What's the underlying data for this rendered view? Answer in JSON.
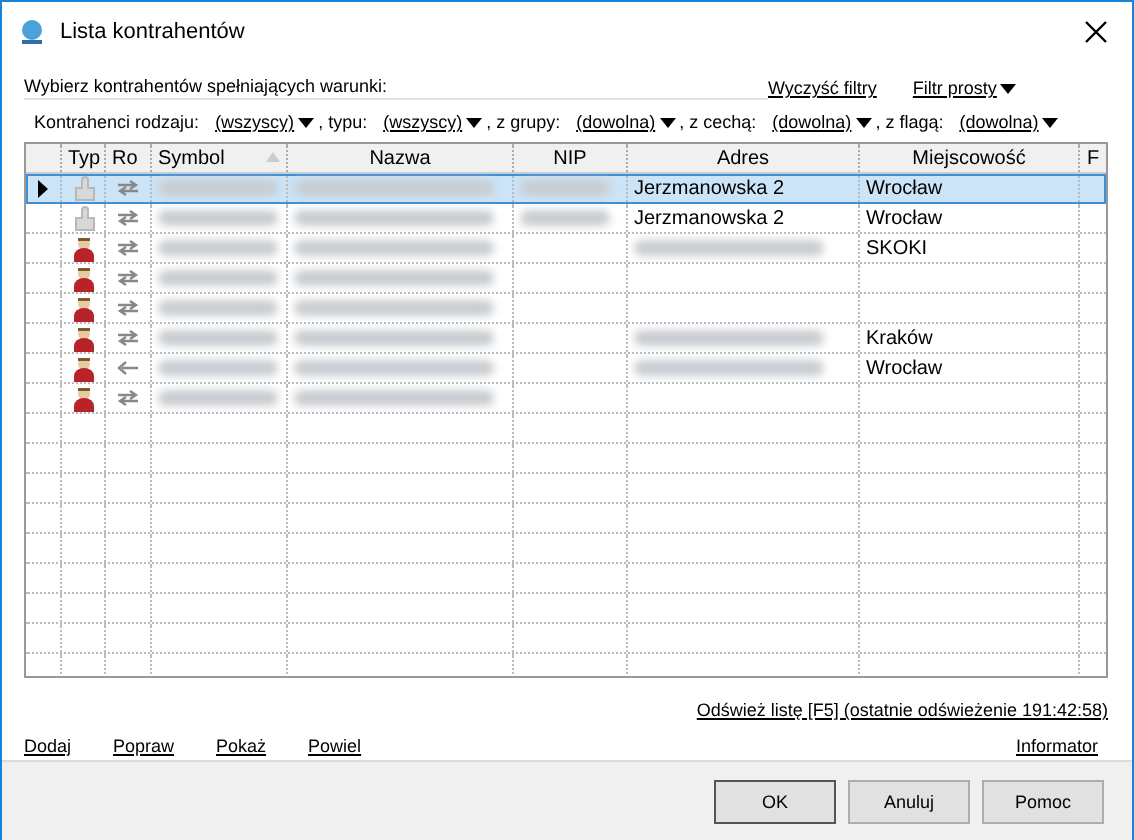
{
  "window": {
    "title": "Lista kontrahentów"
  },
  "filter_heading": "Wybierz kontrahentów spełniających warunki:",
  "filter_links": [
    {
      "label": "Wyczyść filtry",
      "kind": "link"
    },
    {
      "label": "Filtr prosty",
      "kind": "menu"
    }
  ],
  "filters": [
    {
      "label": "Kontrahenci rodzaju:",
      "value": "(wszyscy)"
    },
    {
      "label": ", typu:",
      "value": "(wszyscy)"
    },
    {
      "label": ", z grupy:",
      "value": "(dowolna)"
    },
    {
      "label": ", z cechą:",
      "value": "(dowolna)"
    },
    {
      "label": ", z flagą:",
      "value": "(dowolna)"
    }
  ],
  "table": {
    "columns": [
      {
        "label": "Typ",
        "sorted": false
      },
      {
        "label": "Ro",
        "sorted": false
      },
      {
        "label": "Symbol",
        "sorted": true
      },
      {
        "label": "Nazwa",
        "sorted": false
      },
      {
        "label": "NIP",
        "sorted": false
      },
      {
        "label": "Adres",
        "sorted": false
      },
      {
        "label": "Miejscowość",
        "sorted": false
      },
      {
        "label": "F",
        "sorted": false
      }
    ],
    "rows": [
      {
        "selected": true,
        "kind": "inactive",
        "one_way": false,
        "nip_blurred": true,
        "address_blurred": false,
        "address": "Jerzmanowska 2",
        "city": "Wrocław"
      },
      {
        "selected": false,
        "kind": "inactive",
        "one_way": false,
        "nip_blurred": true,
        "address_blurred": false,
        "address": "Jerzmanowska 2",
        "city": "Wrocław"
      },
      {
        "selected": false,
        "kind": "person",
        "one_way": false,
        "nip_blurred": false,
        "address_blurred": true,
        "city": "SKOKI"
      },
      {
        "selected": false,
        "kind": "person",
        "one_way": false,
        "nip_blurred": false,
        "address_blurred": false
      },
      {
        "selected": false,
        "kind": "person",
        "one_way": false,
        "nip_blurred": false,
        "address_blurred": false
      },
      {
        "selected": false,
        "kind": "person",
        "one_way": false,
        "nip_blurred": false,
        "address_blurred": true,
        "city": "Kraków"
      },
      {
        "selected": false,
        "kind": "person",
        "one_way": true,
        "nip_blurred": false,
        "address_blurred": true,
        "city": "Wrocław"
      },
      {
        "selected": false,
        "kind": "person",
        "one_way": false,
        "nip_blurred": false,
        "address_blurred": false
      }
    ]
  },
  "refresh_link": "Odśwież listę [F5] (ostatnie odświeżenie 191:42:58)",
  "actions": [
    "Dodaj",
    "Popraw",
    "Pokaż",
    "Powiel"
  ],
  "info_link": "Informator",
  "buttons": [
    {
      "label": "OK",
      "default": true
    },
    {
      "label": "Anuluj",
      "default": false
    },
    {
      "label": "Pomoc",
      "default": false
    }
  ]
}
